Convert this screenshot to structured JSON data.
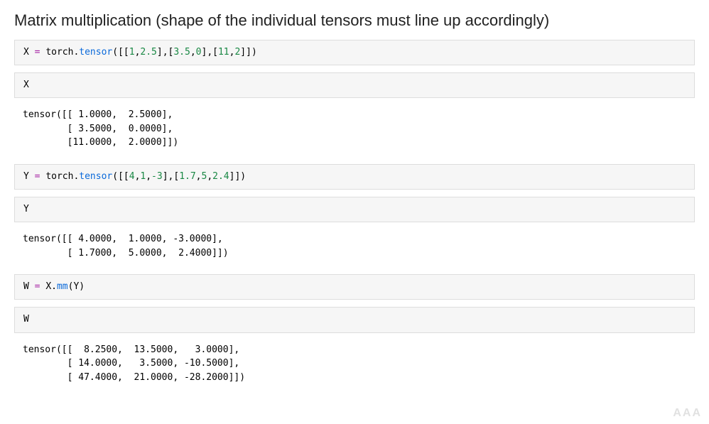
{
  "heading": "Matrix multiplication (shape of the individual tensors must line up accordingly)",
  "cells": {
    "c1": {
      "var": "X",
      "eq": " = ",
      "mod": "torch.",
      "fn": "tensor",
      "open": "([[",
      "n1": "1",
      "c1": ",",
      "n2": "2.5",
      "c2": "],[",
      "n3": "3.5",
      "c3": ",",
      "n4": "0",
      "c4": "],[",
      "n5": "11",
      "c5": ",",
      "n6": "2",
      "close": "]])"
    },
    "c2": {
      "expr": "X"
    },
    "o2": "tensor([[ 1.0000,  2.5000],\n        [ 3.5000,  0.0000],\n        [11.0000,  2.0000]])",
    "c3": {
      "var": "Y",
      "eq": " = ",
      "mod": "torch.",
      "fn": "tensor",
      "open": "([[",
      "n1": "4",
      "c1": ",",
      "n2": "1",
      "c2": ",",
      "n3": "-3",
      "c3": "],[",
      "n4": "1.7",
      "c4": ",",
      "n5": "5",
      "c5": ",",
      "n6": "2.4",
      "close": "]])"
    },
    "c4": {
      "expr": "Y"
    },
    "o4": "tensor([[ 4.0000,  1.0000, -3.0000],\n        [ 1.7000,  5.0000,  2.4000]])",
    "c5": {
      "var": "W",
      "eq": " = ",
      "lhs": "X.",
      "fn": "mm",
      "open": "(",
      "arg": "Y",
      "close": ")"
    },
    "c6": {
      "expr": "W"
    },
    "o6": "tensor([[  8.2500,  13.5000,   3.0000],\n        [ 14.0000,   3.5000, -10.5000],\n        [ 47.4000,  21.0000, -28.2000]])"
  },
  "watermark": "AAA"
}
